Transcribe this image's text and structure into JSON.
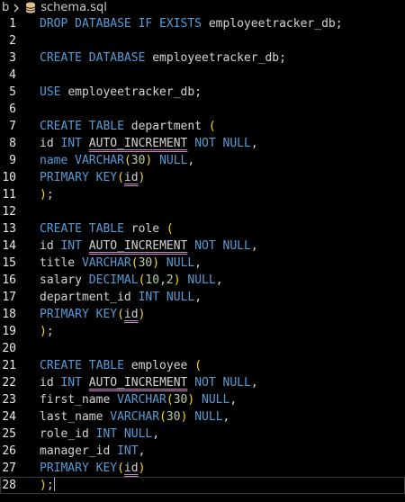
{
  "breadcrumb": {
    "root": "b",
    "file_name": "schema.sql"
  },
  "colors": {
    "background": "#000000",
    "keyword": "#569cd6",
    "identifier": "#d4d4d4",
    "number": "#b5cea8",
    "paren": "#ffd700",
    "squiggle": "#c586c0",
    "line_number": "#e8e8e8",
    "icon": "#e2c08d"
  },
  "lines": [
    {
      "n": "1",
      "tokens": [
        [
          "kw",
          "DROP DATABASE IF EXISTS "
        ],
        [
          "id",
          "employeetracker_db"
        ],
        [
          "pun",
          ";"
        ]
      ]
    },
    {
      "n": "2",
      "tokens": []
    },
    {
      "n": "3",
      "tokens": [
        [
          "kw",
          "CREATE DATABASE "
        ],
        [
          "id",
          "employeetracker_db"
        ],
        [
          "pun",
          ";"
        ]
      ]
    },
    {
      "n": "4",
      "tokens": []
    },
    {
      "n": "5",
      "tokens": [
        [
          "kw",
          "USE "
        ],
        [
          "id",
          "employeetracker_db"
        ],
        [
          "pun",
          ";"
        ]
      ]
    },
    {
      "n": "6",
      "tokens": []
    },
    {
      "n": "7",
      "tokens": [
        [
          "kw",
          "CREATE TABLE "
        ],
        [
          "id",
          "department "
        ],
        [
          "par1",
          "("
        ]
      ]
    },
    {
      "n": "8",
      "tokens": [
        [
          "id",
          "id "
        ],
        [
          "kw",
          "INT "
        ],
        [
          "sq",
          "AUTO_INCREMENT"
        ],
        [
          "kw",
          " NOT NULL"
        ],
        [
          "pun",
          ","
        ]
      ]
    },
    {
      "n": "9",
      "tokens": [
        [
          "kw",
          "name "
        ],
        [
          "kw",
          "VARCHAR"
        ],
        [
          "par1",
          "("
        ],
        [
          "num",
          "30"
        ],
        [
          "par1",
          ")"
        ],
        [
          "kw",
          " NULL"
        ],
        [
          "pun",
          ","
        ]
      ]
    },
    {
      "n": "10",
      "tokens": [
        [
          "kw",
          "PRIMARY KEY"
        ],
        [
          "par1",
          "("
        ],
        [
          "sq",
          "id"
        ],
        [
          "par1",
          ")"
        ]
      ]
    },
    {
      "n": "11",
      "tokens": [
        [
          "par1",
          ")"
        ],
        [
          "pun",
          ";"
        ]
      ]
    },
    {
      "n": "12",
      "tokens": []
    },
    {
      "n": "13",
      "tokens": [
        [
          "kw",
          "CREATE TABLE "
        ],
        [
          "id",
          "role "
        ],
        [
          "par1",
          "("
        ]
      ]
    },
    {
      "n": "14",
      "tokens": [
        [
          "id",
          "id "
        ],
        [
          "kw",
          "INT "
        ],
        [
          "sq",
          "AUTO_INCREMENT"
        ],
        [
          "kw",
          " NOT NULL"
        ],
        [
          "pun",
          ","
        ]
      ]
    },
    {
      "n": "15",
      "tokens": [
        [
          "id",
          "title "
        ],
        [
          "kw",
          "VARCHAR"
        ],
        [
          "par1",
          "("
        ],
        [
          "num",
          "30"
        ],
        [
          "par1",
          ")"
        ],
        [
          "kw",
          " NULL"
        ],
        [
          "pun",
          ","
        ]
      ]
    },
    {
      "n": "16",
      "tokens": [
        [
          "id",
          "salary "
        ],
        [
          "kw",
          "DECIMAL"
        ],
        [
          "par1",
          "("
        ],
        [
          "num",
          "10"
        ],
        [
          "pun",
          ","
        ],
        [
          "num",
          "2"
        ],
        [
          "par1",
          ")"
        ],
        [
          "kw",
          " NULL"
        ],
        [
          "pun",
          ","
        ]
      ]
    },
    {
      "n": "17",
      "tokens": [
        [
          "id",
          "department_id "
        ],
        [
          "kw",
          "INT"
        ],
        [
          "kw",
          " NULL"
        ],
        [
          "pun",
          ","
        ]
      ]
    },
    {
      "n": "18",
      "tokens": [
        [
          "kw",
          "PRIMARY KEY"
        ],
        [
          "par1",
          "("
        ],
        [
          "sq",
          "id"
        ],
        [
          "par1",
          ")"
        ]
      ]
    },
    {
      "n": "19",
      "tokens": [
        [
          "par1",
          ")"
        ],
        [
          "pun",
          ";"
        ]
      ]
    },
    {
      "n": "20",
      "tokens": []
    },
    {
      "n": "21",
      "tokens": [
        [
          "kw",
          "CREATE TABLE "
        ],
        [
          "id",
          "employee "
        ],
        [
          "par1",
          "("
        ]
      ]
    },
    {
      "n": "22",
      "tokens": [
        [
          "id",
          "id "
        ],
        [
          "kw",
          "INT "
        ],
        [
          "sq",
          "AUTO_INCREMENT"
        ],
        [
          "kw",
          " NOT NULL"
        ],
        [
          "pun",
          ","
        ]
      ]
    },
    {
      "n": "23",
      "tokens": [
        [
          "id",
          "first_name "
        ],
        [
          "kw",
          "VARCHAR"
        ],
        [
          "par1",
          "("
        ],
        [
          "num",
          "30"
        ],
        [
          "par1",
          ")"
        ],
        [
          "kw",
          " NULL"
        ],
        [
          "pun",
          ","
        ]
      ]
    },
    {
      "n": "24",
      "tokens": [
        [
          "id",
          "last_name "
        ],
        [
          "kw",
          "VARCHAR"
        ],
        [
          "par1",
          "("
        ],
        [
          "num",
          "30"
        ],
        [
          "par1",
          ")"
        ],
        [
          "kw",
          " NULL"
        ],
        [
          "pun",
          ","
        ]
      ]
    },
    {
      "n": "25",
      "tokens": [
        [
          "id",
          "role_id "
        ],
        [
          "kw",
          "INT"
        ],
        [
          "kw",
          " NULL"
        ],
        [
          "pun",
          ","
        ]
      ]
    },
    {
      "n": "26",
      "tokens": [
        [
          "id",
          "manager_id "
        ],
        [
          "kw",
          "INT"
        ],
        [
          "pun",
          ","
        ]
      ]
    },
    {
      "n": "27",
      "tokens": [
        [
          "kw",
          "PRIMARY KEY"
        ],
        [
          "par1",
          "("
        ],
        [
          "sq",
          "id"
        ],
        [
          "par1",
          ")"
        ]
      ]
    },
    {
      "n": "28",
      "tokens": [
        [
          "par1",
          ")"
        ],
        [
          "pun",
          ";"
        ]
      ]
    }
  ],
  "current_line": "28"
}
